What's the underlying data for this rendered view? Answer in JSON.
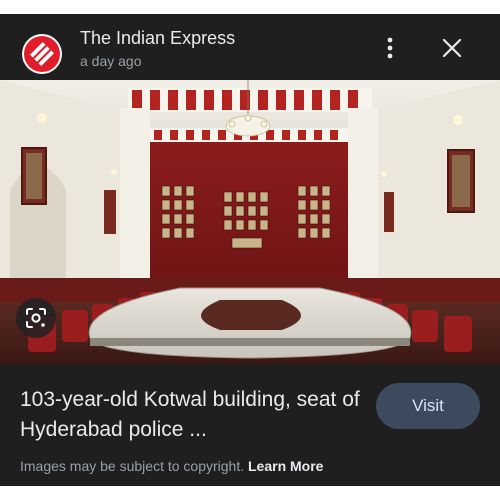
{
  "header": {
    "source_name": "The Indian Express",
    "timestamp": "a day ago",
    "logo_icon": "indian-express-logo",
    "more_icon": "more-vert-icon",
    "close_icon": "close-icon"
  },
  "image": {
    "lens_icon": "google-lens-icon"
  },
  "result": {
    "title": "103-year-old Kotwal building, seat of Hyderabad police ...",
    "visit_label": "Visit"
  },
  "footer": {
    "copyright_text": "Images may be subject to copyright.",
    "learn_more_label": "Learn More"
  },
  "colors": {
    "background": "#1f1f1f",
    "visit_button": "#3c4a5e",
    "brand_red": "#e11d2a"
  }
}
